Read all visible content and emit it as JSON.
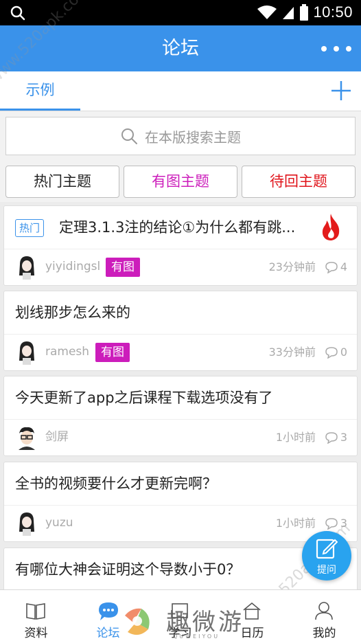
{
  "status_bar": {
    "time": "10:50"
  },
  "header": {
    "title": "论坛"
  },
  "tabs": [
    {
      "label": "示例"
    }
  ],
  "search": {
    "placeholder": "在本版搜索主题"
  },
  "filters": [
    {
      "label": "热门主题",
      "color": "#222222"
    },
    {
      "label": "有图主题",
      "color": "#cc1dbb"
    },
    {
      "label": "待回主题",
      "color": "#e0141b"
    }
  ],
  "posts": [
    {
      "tag": "热门",
      "title": "定理3.1.3注的结论①为什么都有跳...",
      "author": "yiyidingsl",
      "has_image_badge": "有图",
      "time": "23分钟前",
      "replies": "4"
    },
    {
      "title": "划线那步怎么来的",
      "author": "ramesh",
      "has_image_badge": "有图",
      "time": "33分钟前",
      "replies": "0"
    },
    {
      "title": "今天更新了app之后课程下载选项没有了",
      "author": "剑屏",
      "time": "1小时前",
      "replies": "3"
    },
    {
      "title": "全书的视频要什么才更新完啊？",
      "author": "yuzu",
      "time": "1小时前",
      "replies": "3"
    },
    {
      "title": "有哪位大神会证明这个导数小于0？"
    }
  ],
  "fab": {
    "label": "提问"
  },
  "bottom_nav": [
    {
      "label": "资料",
      "icon": "book-icon"
    },
    {
      "label": "论坛",
      "icon": "chat-bubble-icon"
    },
    {
      "label": "学习",
      "icon": "study-icon"
    },
    {
      "label": "日历",
      "icon": "calendar-icon"
    },
    {
      "label": "我的",
      "icon": "person-icon"
    }
  ],
  "watermarks": {
    "diagonal_top": "www.520apk.com",
    "diagonal_bottom": "www.520apk.com",
    "logo_text": "趣微游",
    "logo_sub": "QUWEIYOU"
  },
  "colors": {
    "primary": "#3a92ea",
    "badge_image": "#cc1dbb",
    "hot_red": "#e0141b",
    "fab": "#29a3ef"
  }
}
